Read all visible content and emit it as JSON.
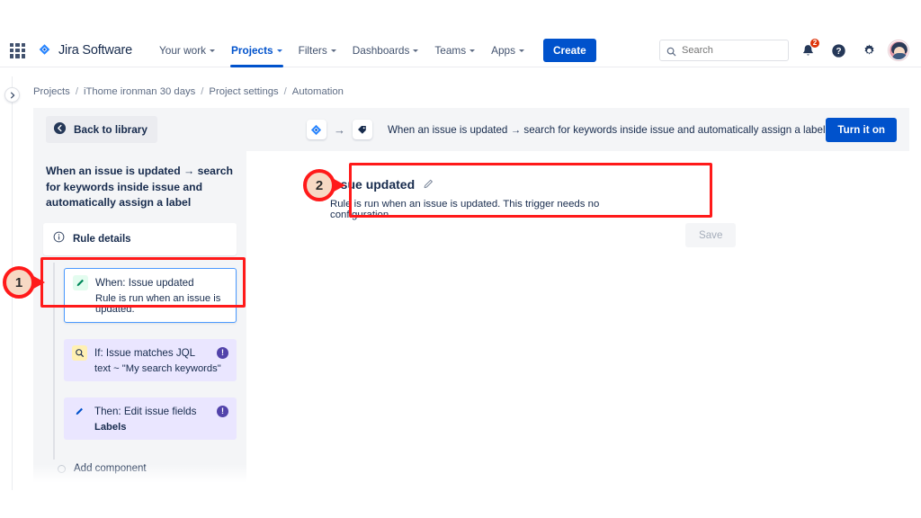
{
  "topnav": {
    "apps_icon": "apps-grid-icon",
    "brand": "Jira Software",
    "items": [
      {
        "label": "Your work",
        "has_caret": true,
        "active": false
      },
      {
        "label": "Projects",
        "has_caret": true,
        "active": true
      },
      {
        "label": "Filters",
        "has_caret": true,
        "active": false
      },
      {
        "label": "Dashboards",
        "has_caret": true,
        "active": false
      },
      {
        "label": "Teams",
        "has_caret": true,
        "active": false
      },
      {
        "label": "Apps",
        "has_caret": true,
        "active": false
      }
    ],
    "create_label": "Create",
    "search_placeholder": "Search",
    "notifications_count": "2",
    "accent_color": "#0052cc",
    "badge_color": "#de350b"
  },
  "breadcrumb": {
    "items": [
      "Projects",
      "iThome ironman 30 days",
      "Project settings",
      "Automation"
    ],
    "separator": "/"
  },
  "toolbar": {
    "back_label": "Back to library",
    "rule_title": "When an issue is updated → search for keywords inside issue and automatically assign a label",
    "chain_arrow": "→",
    "turn_on_label": "Turn it on"
  },
  "sidebar": {
    "title": "When an issue is updated → search for keywords inside issue and automatically assign a label",
    "rule_details_label": "Rule details",
    "components": [
      {
        "title": "When: Issue updated",
        "subtitle": "Rule is run when an issue is updated.",
        "icon": "pencil-icon",
        "style": "selected",
        "error": false
      },
      {
        "title": "If: Issue matches JQL",
        "subtitle": "text ~ \"My search keywords\"",
        "icon": "search-icon",
        "style": "lilac",
        "error": true,
        "error_mark": "!"
      },
      {
        "title": "Then: Edit issue fields",
        "subtitle": "Labels",
        "icon": "pencil-icon",
        "style": "lilac",
        "error": true,
        "error_mark": "!"
      }
    ],
    "add_component_label": "Add component"
  },
  "detail": {
    "title": "Issue updated",
    "description": "Rule is run when an issue is updated. This trigger needs no configuration.",
    "edit_icon": "pencil-edit-icon",
    "save_label": "Save",
    "save_disabled": true
  },
  "annotations": [
    {
      "number": "1",
      "target": "when-issue-updated-component"
    },
    {
      "number": "2",
      "target": "issue-updated-detail-card"
    }
  ]
}
